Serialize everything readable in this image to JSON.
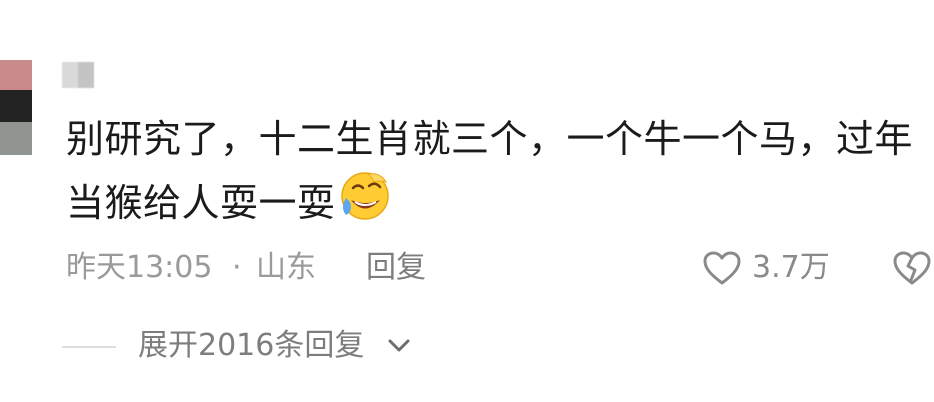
{
  "comment": {
    "text_line_1": "别研究了，十二生肖就三个，一个牛一个马，过年",
    "text_line_2": "当猴给人耍一耍",
    "emoji": "laughing-crying-face-icon"
  },
  "meta": {
    "time": "昨天13:05",
    "separator": "·",
    "location": "山东",
    "reply_label": "回复"
  },
  "actions": {
    "like_count": "3.7万",
    "like_icon": "heart-outline-icon",
    "dislike_icon": "broken-heart-icon"
  },
  "replies": {
    "expand_label": "展开2016条回复",
    "expand_icon": "chevron-down-icon"
  },
  "colors": {
    "text_primary": "#1b1b1b",
    "text_secondary": "#9a9a9a",
    "emoji_yellow": "#ffcc33",
    "emoji_tear": "#5aa7f0"
  }
}
